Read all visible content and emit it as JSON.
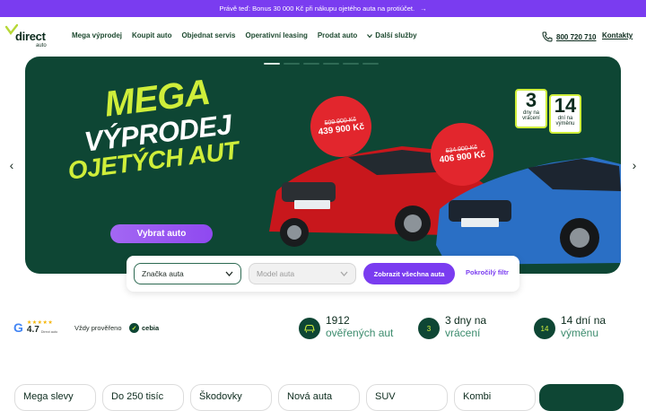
{
  "promo": {
    "text": "Právě teď: Bonus 30 000 Kč při nákupu ojetého auta na protiúčet.",
    "arrow": "→"
  },
  "logo": {
    "word": "direct",
    "sub": "auto"
  },
  "menu": [
    {
      "label": "Mega výprodej"
    },
    {
      "label": "Koupit auto"
    },
    {
      "label": "Objednat servis"
    },
    {
      "label": "Operativní leasing"
    },
    {
      "label": "Prodat auto"
    },
    {
      "label": "Další služby"
    }
  ],
  "contact": {
    "phone": "800 720 710",
    "contacts_label": "Kontakty"
  },
  "carousel": {
    "prev": "‹",
    "next": "›"
  },
  "hero": {
    "headline_1": "MEGA",
    "headline_2": "VÝPRODEJ",
    "headline_3": "OJETÝCH AUT",
    "cta": "Vybrat auto",
    "price_1_old": "509 900 Kč",
    "price_1_new": "439 900 Kč",
    "price_2_old": "634 900 Kč",
    "price_2_new": "406 900 Kč",
    "badge_1_num": "3",
    "badge_1_text": "dny na vrácení",
    "badge_2_num": "14",
    "badge_2_text": "dní na výměnu"
  },
  "filter": {
    "brand_placeholder": "Značka auta",
    "model_placeholder": "Model auta",
    "show_all": "Zobrazit všechna auta",
    "advanced": "Pokročilý filtr"
  },
  "trust": {
    "google": "G",
    "stars": "★★★★★",
    "rating": "4.7",
    "rating_note": "Direct auto",
    "verified": "Vždy prověřeno",
    "cebia": "cebia"
  },
  "stats": [
    {
      "a": "1912",
      "b": "ověřených aut"
    },
    {
      "a": "3 dny na",
      "b": "vrácení"
    },
    {
      "a": "14 dní na",
      "b": "výměnu"
    }
  ],
  "stat_icons": [
    "car-icon",
    "3",
    "14"
  ],
  "categories": [
    "Mega slevy",
    "Do 250 tisíc",
    "Škodovky",
    "Nová auta",
    "SUV",
    "Kombi"
  ],
  "colors": {
    "accent": "#7a3cf0",
    "brand_dark": "#0e4634",
    "lime": "#cfee3a",
    "price_red": "#e2262d"
  }
}
